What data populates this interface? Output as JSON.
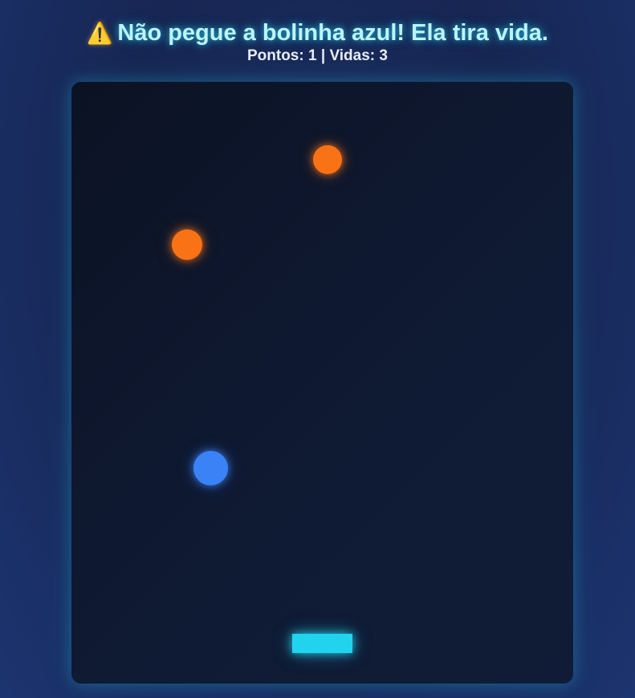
{
  "header": {
    "warning_icon": "⚠️",
    "title": "Não pegue a bolinha azul! Ela tira vida."
  },
  "hud": {
    "points_label": "Pontos:",
    "points": 1,
    "separator": "|",
    "lives_label": "Vidas:",
    "lives": 3
  },
  "colors": {
    "background": "#1a2c5e",
    "board": "#0f1a33",
    "title_glow": "#22d3ee",
    "paddle": "#22d3ee",
    "orange_ball": "#f97316",
    "blue_ball": "#3b82f6"
  },
  "icons": {
    "warning": "warning-icon"
  },
  "game": {
    "orange_balls": 2,
    "blue_balls": 1
  }
}
